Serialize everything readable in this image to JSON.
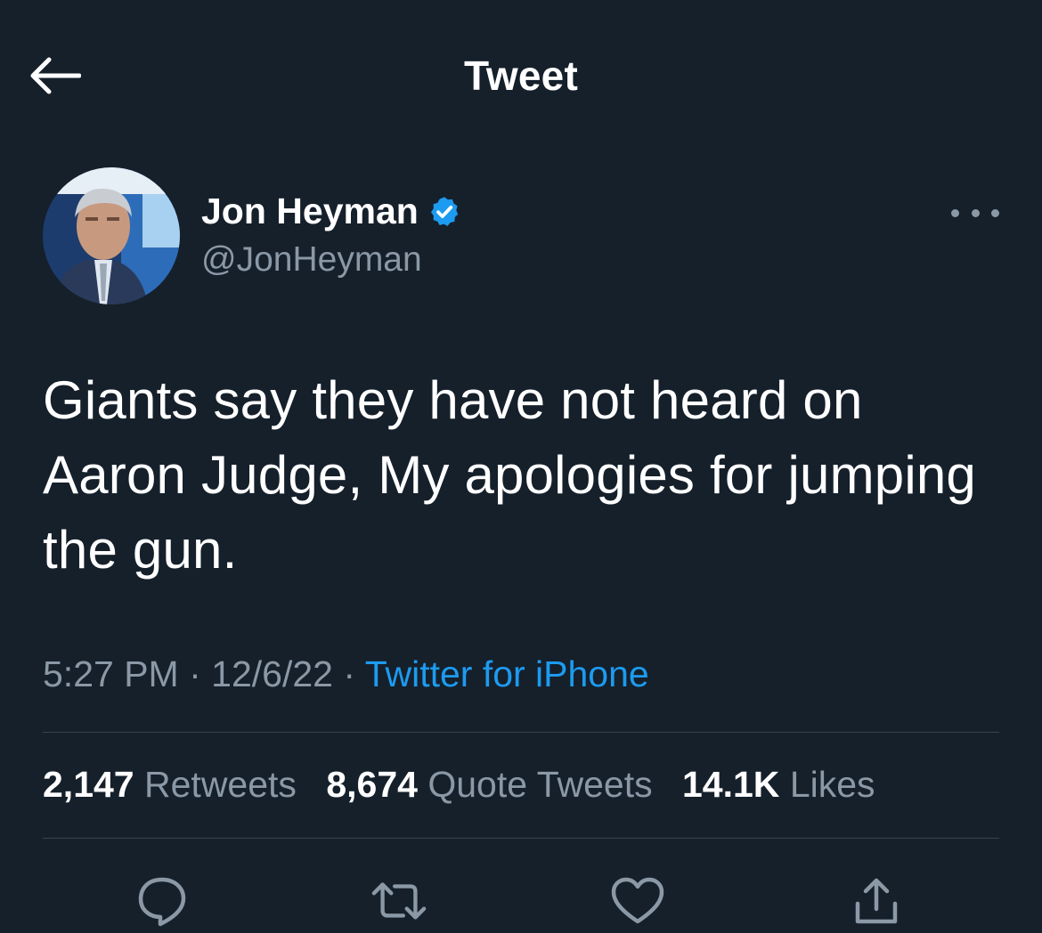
{
  "header": {
    "title": "Tweet",
    "back_icon": "arrow-left-icon"
  },
  "author": {
    "display_name": "Jon Heyman",
    "handle": "@JonHeyman",
    "verified_icon": "verified-badge-icon",
    "avatar": "avatar-photo"
  },
  "tweet": {
    "text": "Giants say they have not heard on Aaron Judge, My apologies for jumping the gun.",
    "time": "5:27 PM",
    "separator": "·",
    "date": "12/6/22",
    "source": "Twitter for iPhone"
  },
  "stats": {
    "retweets_count": "2,147",
    "retweets_label": "Retweets",
    "quotes_count": "8,674",
    "quotes_label": "Quote Tweets",
    "likes_count": "14.1K",
    "likes_label": "Likes"
  },
  "actions": [
    "reply-icon",
    "retweet-icon",
    "like-icon",
    "share-icon"
  ],
  "colors": {
    "background": "#15202b",
    "text_primary": "#ffffff",
    "text_secondary": "#8b98a5",
    "accent": "#1d9bf0",
    "divider": "#38444d"
  }
}
